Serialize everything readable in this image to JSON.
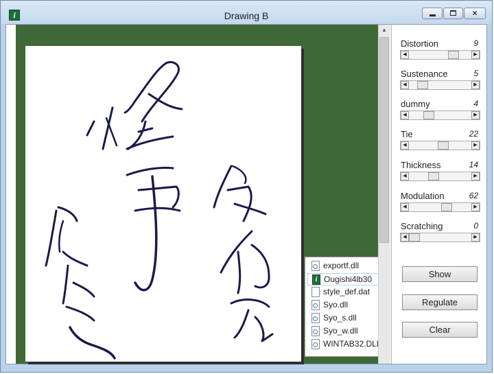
{
  "window": {
    "title": "Drawing B",
    "app_icon_glyph": "i",
    "app_icon_name": "app-icon"
  },
  "controls": {
    "minimize_icon": "minimize-icon",
    "maximize_icon": "maximize-icon",
    "close_icon": "close-icon"
  },
  "canvas": {
    "background_color": "#3f6837",
    "paper_color": "#ffffff",
    "ink_color": "#1a1a4a"
  },
  "parameters": [
    {
      "label": "Distortion",
      "value": "9"
    },
    {
      "label": "Sustenance",
      "value": "5"
    },
    {
      "label": "dummy",
      "value": "4"
    },
    {
      "label": "Tie",
      "value": "22"
    },
    {
      "label": "Thickness",
      "value": "14"
    },
    {
      "label": "Modulation",
      "value": "62"
    },
    {
      "label": "Scratching",
      "value": "0"
    }
  ],
  "buttons": {
    "show": "Show",
    "regulate": "Regulate",
    "clear": "Clear"
  },
  "files": [
    {
      "name": "exportf.dll",
      "icon": "dll-file-icon"
    },
    {
      "name": "Ougishi4lb30",
      "icon": "app-file-icon"
    },
    {
      "name": "style_def.dat",
      "icon": "data-file-icon"
    },
    {
      "name": "Syo.dll",
      "icon": "dll-file-icon"
    },
    {
      "name": "Syo_s.dll",
      "icon": "dll-file-icon"
    },
    {
      "name": "Syo_w.dll",
      "icon": "dll-file-icon"
    },
    {
      "name": "WINTAB32.DLL",
      "icon": "dll-file-icon"
    }
  ],
  "selected_file": "Ougishi4lb30"
}
